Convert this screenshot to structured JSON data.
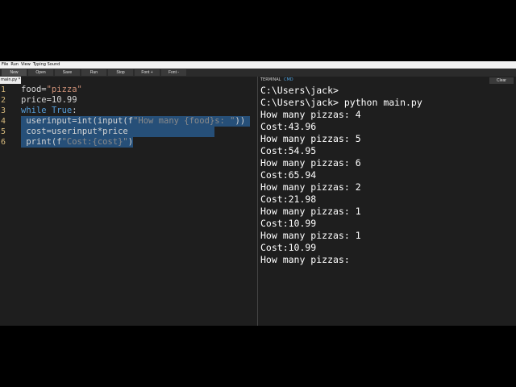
{
  "menu": [
    "File",
    "Run",
    "View",
    "Typing Sound"
  ],
  "toolbar": {
    "new": "New",
    "open": "Open",
    "save": "Save",
    "run": "Run",
    "stop": "Stop",
    "font_plus": "Font +",
    "font_minus": "Font -"
  },
  "editor": {
    "tab": "main.py *",
    "line_numbers": [
      "1",
      "2",
      "3",
      "4",
      "5",
      "6"
    ]
  },
  "terminal": {
    "title": "TERMINAL",
    "mode": "CMD",
    "clear": "Clear",
    "lines": [
      "C:\\Users\\jack>",
      "C:\\Users\\jack> python main.py",
      "How many pizzas: 4",
      "Cost:43.96",
      "How many pizzas: 5",
      "Cost:54.95",
      "How many pizzas: 6",
      "Cost:65.94",
      "How many pizzas: 2",
      "Cost:21.98",
      "How many pizzas: 1",
      "Cost:10.99",
      "How many pizzas: 1",
      "Cost:10.99",
      "How many pizzas:"
    ]
  },
  "colors": {
    "background": "#1e1e1e",
    "selection": "#264f78",
    "keyword": "#569cd6",
    "string": "#ce9178",
    "terminal_mode": "#4fa3e0"
  }
}
